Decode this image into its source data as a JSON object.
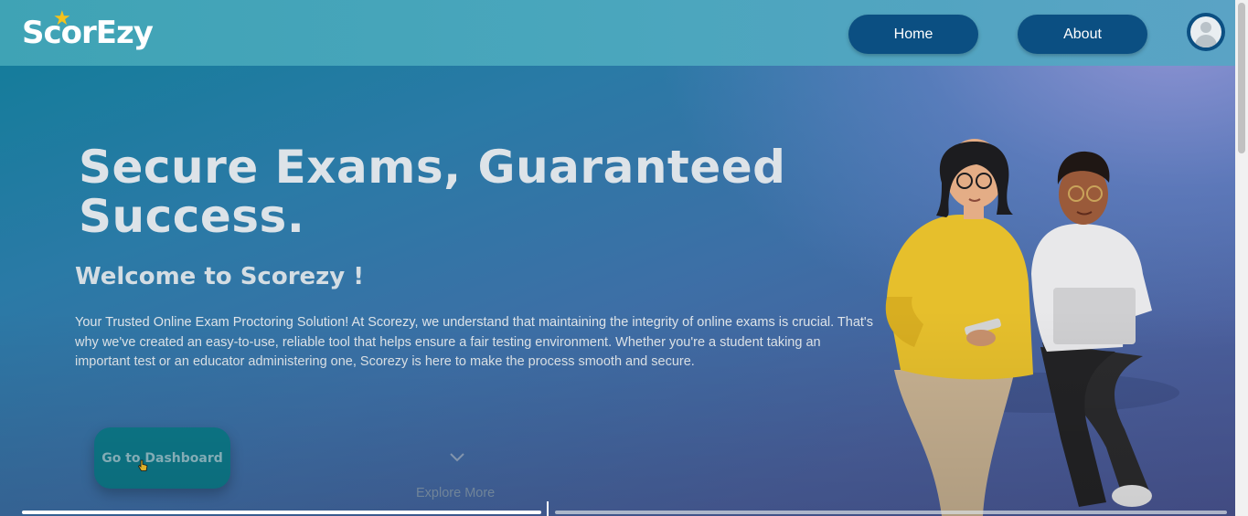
{
  "navbar": {
    "logo_text": "ScorEzy",
    "home_label": "Home",
    "about_label": "About"
  },
  "hero": {
    "title": "Secure Exams, Guaranteed Success.",
    "welcome": "Welcome to Scorezy !",
    "description": "Your Trusted Online Exam Proctoring Solution! At Scorezy, we understand that maintaining the integrity of online exams is crucial. That's why we've created an easy-to-use, reliable tool that helps ensure a fair testing environment. Whether you're a student taking an important test or an educator administering one, Scorezy is here to make the process smooth and secure.",
    "dashboard_button": "Go to Dashboard",
    "explore_label": "Explore More"
  },
  "colors": {
    "nav_button": "#0b4f82",
    "logo_star": "#f6c21a",
    "dashboard_button": "#0d7a8b"
  },
  "icons": {
    "avatar": "user-avatar-icon",
    "chevron": "chevron-down-icon",
    "cursor": "hand-pointer-icon"
  },
  "video_progress": 0.44
}
